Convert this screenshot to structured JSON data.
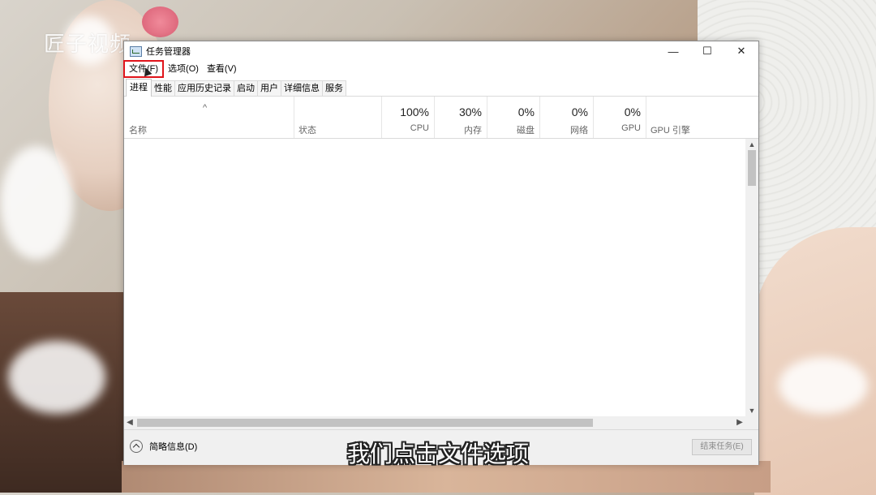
{
  "watermark": "匠子视频",
  "window": {
    "title": "任务管理器",
    "controls": {
      "minimize": "—",
      "maximize": "☐",
      "close": "✕"
    }
  },
  "menu": [
    "文件(F)",
    "选项(O)",
    "查看(V)"
  ],
  "tabs": [
    "进程",
    "性能",
    "应用历史记录",
    "启动",
    "用户",
    "详细信息",
    "服务"
  ],
  "columns": {
    "name": "名称",
    "status": "状态",
    "cpu": {
      "pct": "100%",
      "label": "CPU"
    },
    "memory": {
      "pct": "30%",
      "label": "内存"
    },
    "disk": {
      "pct": "0%",
      "label": "磁盘"
    },
    "network": {
      "pct": "0%",
      "label": "网络"
    },
    "gpu": {
      "pct": "0%",
      "label": "GPU"
    },
    "gpu_engine": "GPU 引擎"
  },
  "footer": {
    "fewer_details": "简略信息(D)",
    "end_task": "结束任务(E)"
  },
  "subtitle": "我们点击文件选项",
  "colors": {
    "highlight": "#e0141b"
  }
}
